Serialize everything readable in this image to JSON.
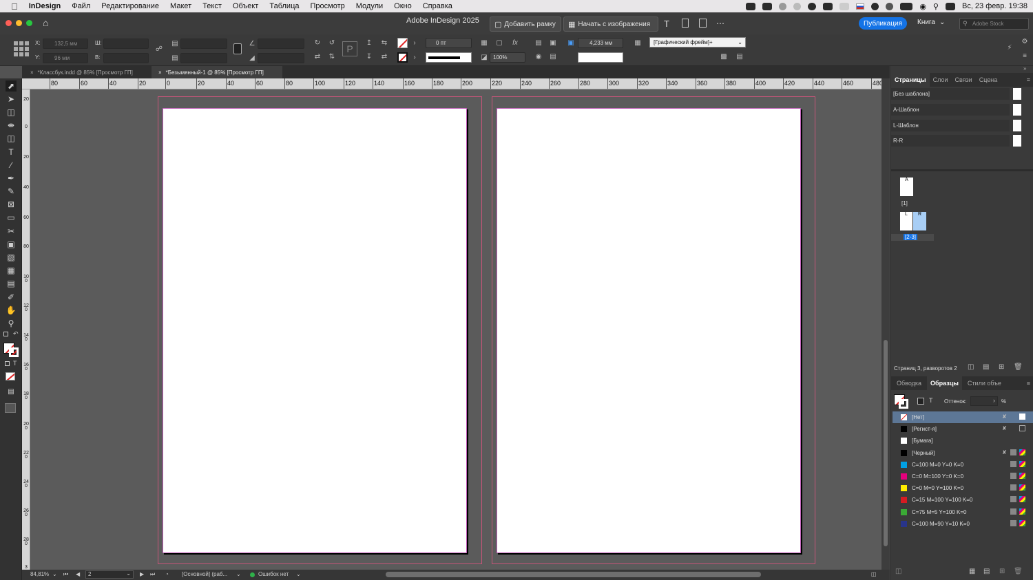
{
  "menubar": {
    "apple": "",
    "app_name": "InDesign",
    "items": [
      "Файл",
      "Редактирование",
      "Макет",
      "Текст",
      "Объект",
      "Таблица",
      "Просмотр",
      "Модули",
      "Окно",
      "Справка"
    ],
    "datetime": "Вс, 23 февр. 19:38"
  },
  "titlebar": {
    "title": "Adobe InDesign 2025",
    "add_frame": "Добавить рамку",
    "start_image": "Начать с изображения",
    "publish": "Публикация",
    "book": "Книга",
    "stock_placeholder": "Adobe Stock"
  },
  "control": {
    "x_label": "X:",
    "x_value": "132,5 мм",
    "y_label": "Y:",
    "y_value": "96 мм",
    "w_label": "Ш:",
    "h_label": "В:",
    "stroke_weight": "0 пт",
    "opacity": "100%",
    "dimension": "4,233 мм",
    "object_style": "[Графический фрейм]+"
  },
  "tabs": [
    {
      "label": "*Классбук.indd @ 85% [Просмотр ГП]",
      "active": false
    },
    {
      "label": "*Безымянный-1 @ 85% [Просмотр ГП]",
      "active": true
    }
  ],
  "hruler": [
    "80",
    "60",
    "40",
    "20",
    "0",
    "20",
    "40",
    "60",
    "80",
    "100",
    "120",
    "140",
    "160",
    "180",
    "200",
    "220",
    "240",
    "260",
    "280",
    "300",
    "320",
    "340",
    "360",
    "380",
    "400",
    "420",
    "440",
    "460",
    "480"
  ],
  "vruler": [
    "20",
    "0",
    "20",
    "40",
    "60",
    "80",
    "100",
    "120",
    "140",
    "160",
    "180",
    "200",
    "220",
    "240",
    "260",
    "280",
    "3"
  ],
  "status": {
    "zoom": "84,81%",
    "page": "2",
    "master": "[Основной] (раб...",
    "errors": "Ошибок нет"
  },
  "pages_panel": {
    "tabs": [
      "Страницы",
      "Слои",
      "Связи",
      "Сцена"
    ],
    "masters": [
      "[Без шаблона]",
      "A-Шаблон",
      "L-Шаблон",
      "R-R"
    ],
    "page1_letter": "A",
    "page1_label": "[1]",
    "spread_left_letter": "L",
    "spread_right_letter": "R",
    "spread_label": "[2-3]",
    "summary": "Страниц 3, разворотов 2"
  },
  "swatches_panel": {
    "tabs": [
      "Обводка",
      "Образцы",
      "Стили объе"
    ],
    "tint_label": "Оттенок:",
    "tint_unit": "%",
    "t_glyph": "T",
    "items": [
      {
        "name": "[Нет]",
        "color": "#ffffff",
        "selected": true
      },
      {
        "name": "[Регист-я]",
        "color": "#000000"
      },
      {
        "name": "[Бумага]",
        "color": "#ffffff"
      },
      {
        "name": "[Черный]",
        "color": "#000000"
      },
      {
        "name": "C=100 M=0 Y=0 K=0",
        "color": "#00a0e3"
      },
      {
        "name": "C=0 M=100 Y=0 K=0",
        "color": "#e4007c"
      },
      {
        "name": "C=0 M=0 Y=100 K=0",
        "color": "#ffed00"
      },
      {
        "name": "C=15 M=100 Y=100 K=0",
        "color": "#d51b22"
      },
      {
        "name": "C=75 M=5 Y=100 K=0",
        "color": "#3aa935"
      },
      {
        "name": "C=100 M=90 Y=10 K=0",
        "color": "#28348a"
      }
    ]
  }
}
